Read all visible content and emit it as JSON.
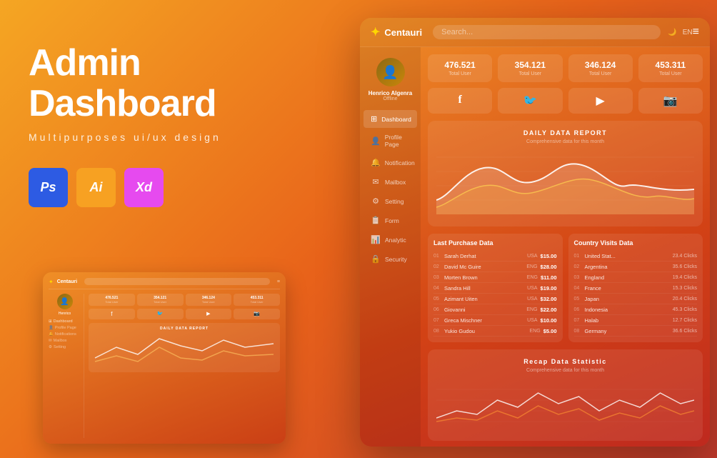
{
  "background": {
    "gradient_start": "#f5a623",
    "gradient_end": "#c0392b"
  },
  "left_panel": {
    "line1": "Admin",
    "line2": "Dashboard",
    "subtitle": "Multipurposes ui/ux design",
    "adobe_ps": "Ps",
    "adobe_ai": "Ai",
    "adobe_xd": "Xd"
  },
  "dashboard": {
    "logo_name": "Centauri",
    "search_placeholder": "Search...",
    "header_right_text": "EN",
    "user": {
      "name": "Henrico Algenra",
      "role": "Offline"
    },
    "nav_items": [
      {
        "icon": "⊞",
        "label": "Dashboard"
      },
      {
        "icon": "👤",
        "label": "Profile Page"
      },
      {
        "icon": "🔔",
        "label": "Notification"
      },
      {
        "icon": "✉",
        "label": "Mailbox"
      },
      {
        "icon": "⚙",
        "label": "Setting"
      },
      {
        "icon": "📋",
        "label": "Form"
      },
      {
        "icon": "📊",
        "label": "Analytic"
      },
      {
        "icon": "🔒",
        "label": "Security"
      }
    ],
    "stats": [
      {
        "number": "476.521",
        "label": "Total User"
      },
      {
        "number": "354.121",
        "label": "Total User"
      },
      {
        "number": "346.124",
        "label": "Total User"
      },
      {
        "number": "453.311",
        "label": "Total User"
      }
    ],
    "social": [
      {
        "icon": "f",
        "platform": "facebook"
      },
      {
        "icon": "🐦",
        "platform": "twitter"
      },
      {
        "icon": "▶",
        "platform": "youtube"
      },
      {
        "icon": "📷",
        "platform": "instagram"
      }
    ],
    "daily_report": {
      "title": "DAILY DATA REPORT",
      "subtitle": "Comprehensive data for this month"
    },
    "last_purchase": {
      "title": "Last Purchase Data",
      "rows": [
        {
          "num": "01",
          "name": "Sarah Derhat",
          "country": "USA",
          "value": "$15.00"
        },
        {
          "num": "02",
          "name": "David Mc Guire",
          "country": "ENG",
          "value": "$28.00"
        },
        {
          "num": "03",
          "name": "Morten Brown",
          "country": "ENG",
          "value": "$11.00"
        },
        {
          "num": "04",
          "name": "Sandra Hill",
          "country": "USA",
          "value": "$19.00"
        },
        {
          "num": "05",
          "name": "Azimant Uiten",
          "country": "USA",
          "value": "$32.00"
        },
        {
          "num": "06",
          "name": "Giovanni",
          "country": "ENG",
          "value": "$22.00"
        },
        {
          "num": "07",
          "name": "Greca Mischner",
          "country": "USA",
          "value": "$10.00"
        },
        {
          "num": "08",
          "name": "Yukio Gudou",
          "country": "ENG",
          "value": "$5.00"
        }
      ]
    },
    "country_visits": {
      "title": "Country Visits Data",
      "rows": [
        {
          "num": "01",
          "name": "United Stat...",
          "clicks": "23.4 Clicks"
        },
        {
          "num": "02",
          "name": "Argentina",
          "clicks": "35.6 Clicks"
        },
        {
          "num": "03",
          "name": "England",
          "clicks": "19.4 Clicks"
        },
        {
          "num": "04",
          "name": "France",
          "clicks": "15.3 Clicks"
        },
        {
          "num": "05",
          "name": "Japan",
          "clicks": "20.4 Clicks"
        },
        {
          "num": "06",
          "name": "Indonesia",
          "clicks": "45.3 Clicks"
        },
        {
          "num": "07",
          "name": "Halab",
          "clicks": "12.7 Clicks"
        },
        {
          "num": "08",
          "name": "Germany",
          "clicks": "36.6 Clicks"
        }
      ]
    },
    "recap": {
      "title": "Recap Data Statistic",
      "subtitle": "Comprehensive data for this month"
    }
  }
}
